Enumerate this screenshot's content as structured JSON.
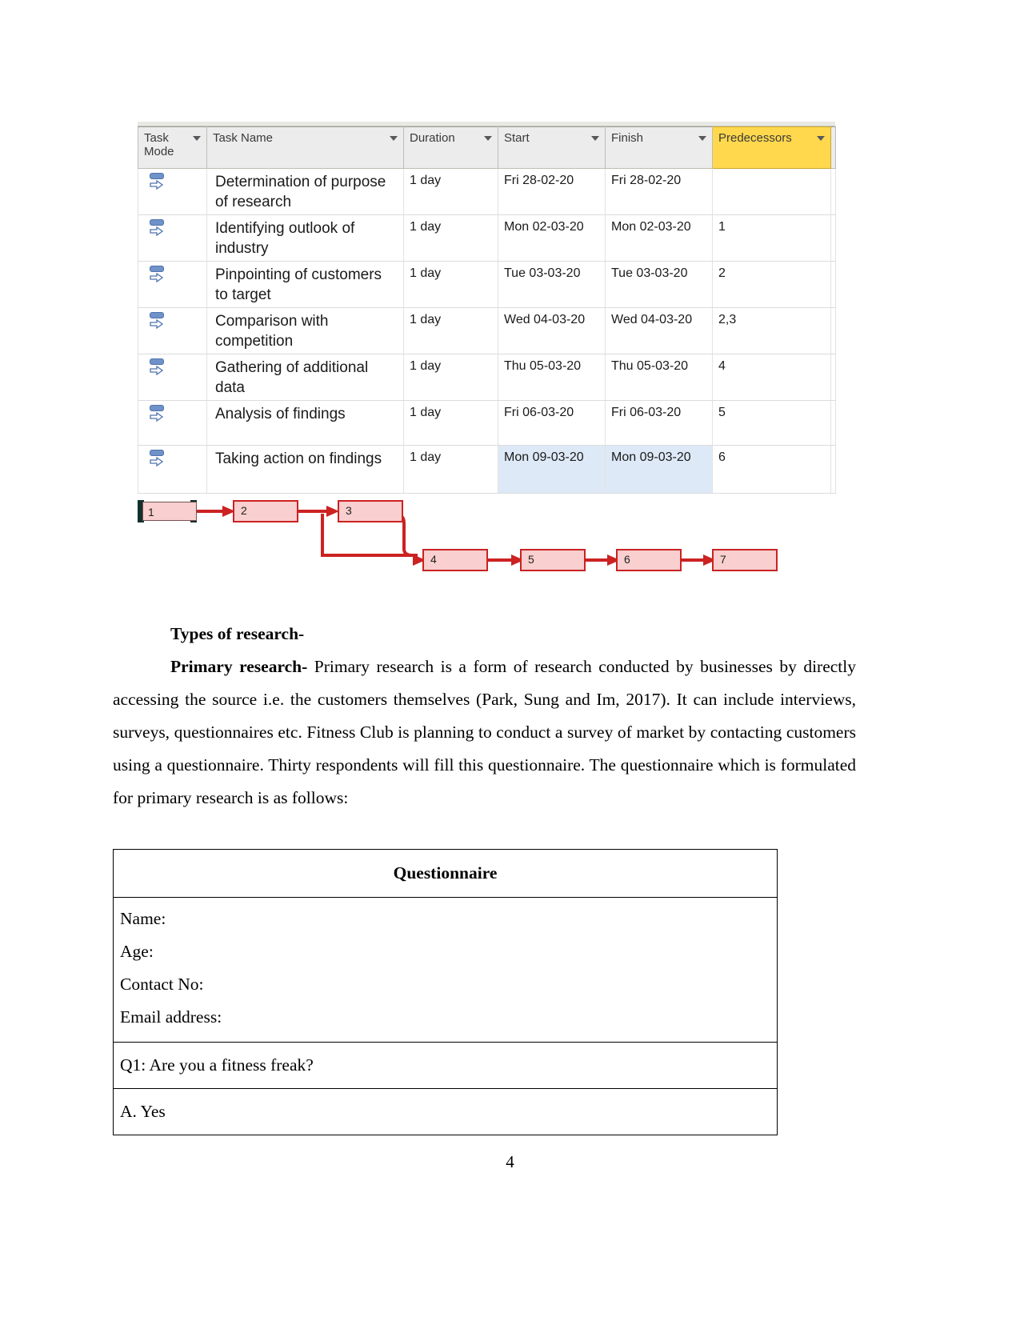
{
  "gantt": {
    "columns": [
      {
        "key": "task_mode",
        "label": "Task Mode",
        "line1": "Task",
        "line2": "Mode"
      },
      {
        "key": "task_name",
        "label": "Task Name"
      },
      {
        "key": "duration",
        "label": "Duration"
      },
      {
        "key": "start",
        "label": "Start"
      },
      {
        "key": "finish",
        "label": "Finish"
      },
      {
        "key": "predecessors",
        "label": "Predecessors"
      }
    ],
    "rows": [
      {
        "task_name": "Determination of purpose of research",
        "duration": "1 day",
        "start": "Fri 28-02-20",
        "finish": "Fri 28-02-20",
        "predecessors": ""
      },
      {
        "task_name": "Identifying outlook of industry",
        "duration": "1 day",
        "start": "Mon 02-03-20",
        "finish": "Mon 02-03-20",
        "predecessors": "1"
      },
      {
        "task_name": "Pinpointing of customers to target",
        "duration": "1 day",
        "start": "Tue 03-03-20",
        "finish": "Tue 03-03-20",
        "predecessors": "2"
      },
      {
        "task_name": "Comparison with competition",
        "duration": "1 day",
        "start": "Wed 04-03-20",
        "finish": "Wed 04-03-20",
        "predecessors": "2,3"
      },
      {
        "task_name": "Gathering of additional data",
        "duration": "1 day",
        "start": "Thu 05-03-20",
        "finish": "Thu 05-03-20",
        "predecessors": "4"
      },
      {
        "task_name": "Analysis of findings",
        "duration": "1 day",
        "start": "Fri 06-03-20",
        "finish": "Fri 06-03-20",
        "predecessors": "5"
      },
      {
        "task_name": "Taking action on findings",
        "duration": "1 day",
        "start": "Mon 09-03-20",
        "finish": "Mon 09-03-20",
        "predecessors": "6"
      }
    ]
  },
  "network": {
    "nodes": [
      {
        "id": "1",
        "label": "1"
      },
      {
        "id": "2",
        "label": "2"
      },
      {
        "id": "3",
        "label": "3"
      },
      {
        "id": "4",
        "label": "4"
      },
      {
        "id": "5",
        "label": "5"
      },
      {
        "id": "6",
        "label": "6"
      },
      {
        "id": "7",
        "label": "7"
      }
    ],
    "colors": {
      "node_fill": "#f9cfcf",
      "node_border": "#cc2222",
      "link": "#cc2222"
    }
  },
  "content": {
    "heading": "Types of research-",
    "subheading": "Primary research-",
    "paragraph": "  Primary research is a form of research conducted by businesses by directly accessing the source i.e. the customers themselves (Park, Sung and Im, 2017). It can include interviews, surveys, questionnaires etc. Fitness Club is planning to conduct a survey of market by contacting customers using a questionnaire. Thirty respondents will fill this questionnaire. The questionnaire which is formulated for primary research is as follows:"
  },
  "questionnaire": {
    "title": "Questionnaire",
    "fields": [
      "Name:",
      "Age:",
      "Contact No:",
      "Email address:"
    ],
    "question": "Q1: Are you a fitness freak?",
    "answer": "A. Yes"
  },
  "footer": {
    "page_number": "4"
  }
}
